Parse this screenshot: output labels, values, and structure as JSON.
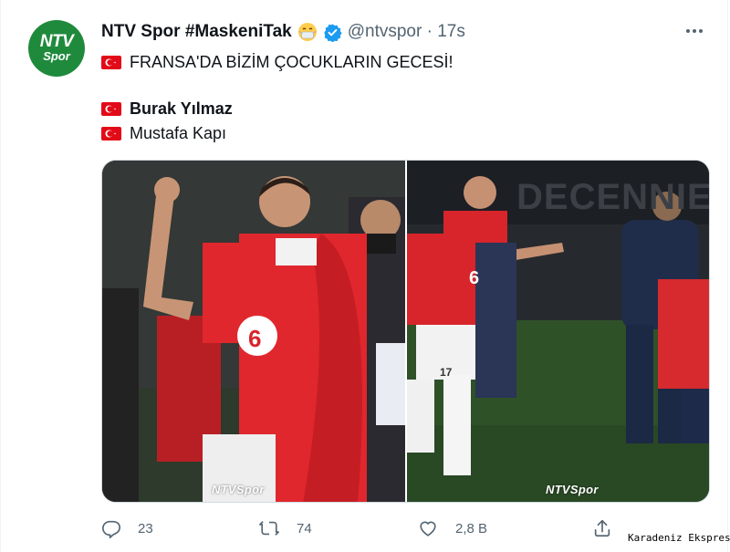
{
  "account": {
    "avatar_line1": "NTV",
    "avatar_line2": "Spor",
    "display_name": "NTV Spor #MaskeniTak",
    "handle_time": "@ntvspor · 17s"
  },
  "tweet": {
    "line1": "FRANSA'DA BİZİM ÇOCUKLARIN GECESİ!",
    "line2": "Burak Yılmaz",
    "line3": "Mustafa Kapı"
  },
  "media": {
    "watermark_left": "NTVSpor",
    "watermark_right": "NTVSpor",
    "jersey_number_left": "6",
    "jersey_number_right": "6",
    "shorts_number": "17",
    "banner_text": "DECENNIE"
  },
  "actions": {
    "reply_count": "23",
    "retweet_count": "74",
    "like_count": "2,8 B"
  },
  "footer": {
    "brand": "Karadeniz Ekspres"
  },
  "colors": {
    "flag_red": "#e30a17",
    "verified_blue": "#1d9bf0",
    "avatar_green": "#1f8a3c",
    "jersey_red": "#d8242b"
  }
}
